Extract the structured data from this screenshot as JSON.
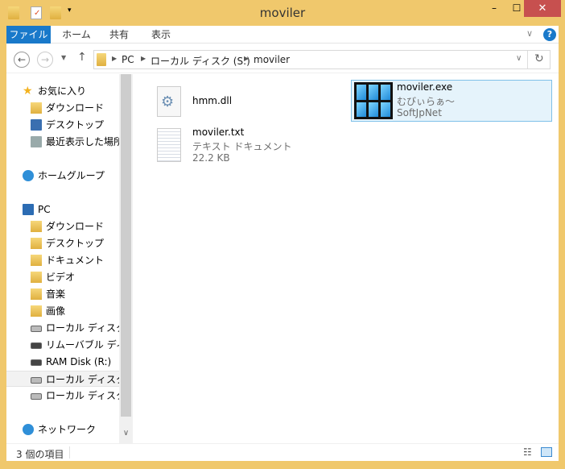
{
  "window": {
    "title": "moviler",
    "close": "✕",
    "minimize": "–",
    "maximize": "☐"
  },
  "ribbon": {
    "tabs": [
      "ファイル",
      "ホーム",
      "共有",
      "表示"
    ],
    "help": "?"
  },
  "address": {
    "crumbs": [
      "PC",
      "ローカル ディスク (S:)",
      "moviler"
    ]
  },
  "nav": {
    "items": [
      {
        "label": "お気に入り",
        "icon": "star-icon"
      },
      {
        "label": "ダウンロード",
        "icon": "download-folder-icon"
      },
      {
        "label": "デスクトップ",
        "icon": "desktop-icon"
      },
      {
        "label": "最近表示した場所",
        "icon": "recent-places-icon"
      },
      {
        "label": "ホームグループ",
        "icon": "homegroup-icon"
      },
      {
        "label": "PC",
        "icon": "pc-icon"
      },
      {
        "label": "ダウンロード",
        "icon": "download-folder-icon"
      },
      {
        "label": "デスクトップ",
        "icon": "desktop-folder-icon"
      },
      {
        "label": "ドキュメント",
        "icon": "documents-folder-icon"
      },
      {
        "label": "ビデオ",
        "icon": "videos-folder-icon"
      },
      {
        "label": "音楽",
        "icon": "music-folder-icon"
      },
      {
        "label": "画像",
        "icon": "pictures-folder-icon"
      },
      {
        "label": "ローカル ディスク (C",
        "icon": "system-drive-icon"
      },
      {
        "label": "リムーバブル ディスク",
        "icon": "removable-drive-icon"
      },
      {
        "label": "RAM Disk (R:)",
        "icon": "drive-icon"
      },
      {
        "label": "ローカル ディスク (S",
        "icon": "drive-icon"
      },
      {
        "label": "ローカル ディスク (X",
        "icon": "drive-icon"
      },
      {
        "label": "ネットワーク",
        "icon": "network-icon"
      }
    ]
  },
  "files": [
    {
      "name": "hmm.dll",
      "icon": "dll-gear-icon"
    },
    {
      "name": "moviler.txt",
      "type": "テキスト ドキュメント",
      "size": "22.2 KB",
      "icon": "text-file-icon"
    },
    {
      "name": "moviler.exe",
      "description": "むびぃらぁ～",
      "company": "SoftJpNet",
      "icon": "filmstrip-app-icon",
      "selected": true
    }
  ],
  "status": {
    "count": "3 個の項目"
  },
  "colors": {
    "frame": "#f0c86c",
    "accent": "#1979ca",
    "close": "#c7504f",
    "selection": "#e5f3fb"
  }
}
